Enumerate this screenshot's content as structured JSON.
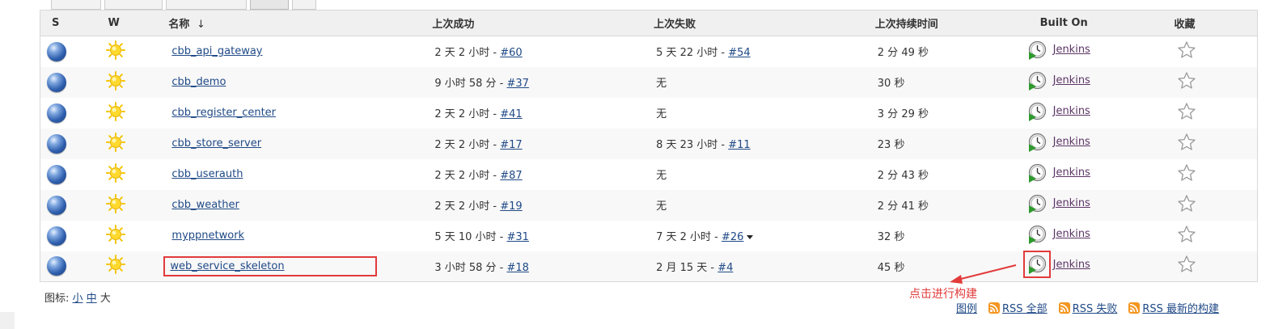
{
  "columns": {
    "status": "S",
    "weather": "W",
    "name": "名称",
    "sort_arrow": "↓",
    "last_success": "上次成功",
    "last_failure": "上次失败",
    "last_duration": "上次持续时间",
    "built_on": "Built On",
    "favorite": "收藏"
  },
  "jobs": [
    {
      "name": "cbb_api_gateway",
      "success_text": "2 天 2 小时 - ",
      "success_build": "#60",
      "failure_text": "5 天 22 小时 - ",
      "failure_build": "#54",
      "duration": "2 分 49 秒",
      "built_on": "Jenkins"
    },
    {
      "name": "cbb_demo",
      "success_text": "9 小时 58 分 - ",
      "success_build": "#37",
      "failure_text": "无",
      "failure_build": "",
      "duration": "30 秒",
      "built_on": "Jenkins"
    },
    {
      "name": "cbb_register_center",
      "success_text": "2 天 2 小时 - ",
      "success_build": "#41",
      "failure_text": "无",
      "failure_build": "",
      "duration": "3 分 29 秒",
      "built_on": "Jenkins"
    },
    {
      "name": "cbb_store_server",
      "success_text": "2 天 2 小时 - ",
      "success_build": "#17",
      "failure_text": "8 天 23 小时 - ",
      "failure_build": "#11",
      "duration": "23 秒",
      "built_on": "Jenkins"
    },
    {
      "name": "cbb_userauth",
      "success_text": "2 天 2 小时 - ",
      "success_build": "#87",
      "failure_text": "无",
      "failure_build": "",
      "duration": "2 分 43 秒",
      "built_on": "Jenkins"
    },
    {
      "name": "cbb_weather",
      "success_text": "2 天 2 小时 - ",
      "success_build": "#19",
      "failure_text": "无",
      "failure_build": "",
      "duration": "2 分 41 秒",
      "built_on": "Jenkins"
    },
    {
      "name": "myppnetwork",
      "success_text": "5 天 10 小时 - ",
      "success_build": "#31",
      "failure_text": "7 天 2 小时 - ",
      "failure_build": "#26",
      "duration": "32 秒",
      "built_on": "Jenkins"
    },
    {
      "name": "web_service_skeleton",
      "success_text": "3 小时 58 分 - ",
      "success_build": "#18",
      "failure_text": "2 月 15 天 - ",
      "failure_build": "#4",
      "duration": "45 秒",
      "built_on": "Jenkins"
    }
  ],
  "icon_size": {
    "label": "图标: ",
    "small": "小",
    "medium": "中",
    "large": "大"
  },
  "annotation": "点击进行构建",
  "footer": {
    "legend": "图例",
    "rss_all": "RSS 全部",
    "rss_failed": "RSS 失败",
    "rss_latest": "RSS 最新的构建"
  },
  "colors": {
    "annotation_red": "#e23b3b",
    "link_blue": "#204a87",
    "rss_orange": "#f39621"
  }
}
